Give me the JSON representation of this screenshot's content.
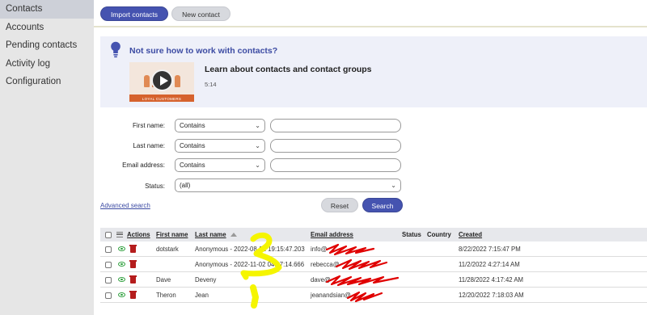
{
  "sidebar": {
    "items": [
      {
        "label": "Contacts",
        "active": true
      },
      {
        "label": "Accounts"
      },
      {
        "label": "Pending contacts"
      },
      {
        "label": "Activity log"
      },
      {
        "label": "Configuration"
      }
    ]
  },
  "toolbar": {
    "import_label": "Import contacts",
    "new_label": "New contact"
  },
  "info": {
    "title": "Not sure how to work with contacts?",
    "video_title": "Learn about contacts and contact groups",
    "video_duration": "5:14",
    "thumbnail_caption": "LOYAL CUSTOMERS",
    "icon": "lightbulb-icon"
  },
  "search": {
    "first_name_label": "First name:",
    "last_name_label": "Last name:",
    "email_label": "Email address:",
    "status_label": "Status:",
    "first_name_operator": "Contains",
    "last_name_operator": "Contains",
    "email_operator": "Contains",
    "status_value": "(all)",
    "advanced_link": "Advanced search",
    "reset_label": "Reset",
    "search_label": "Search"
  },
  "table": {
    "columns": {
      "actions": "Actions",
      "first_name": "First name",
      "last_name": "Last name",
      "email": "Email address",
      "status": "Status",
      "country": "Country",
      "created": "Created"
    },
    "sort": {
      "column": "last_name",
      "direction": "ascending"
    },
    "rows": [
      {
        "first_name": "dotstark",
        "last_name": "Anonymous - 2022-08-22 19:15:47.203",
        "email": "info@",
        "status": "",
        "country": "",
        "created": "8/22/2022 7:15:47 PM"
      },
      {
        "first_name": "",
        "last_name": "Anonymous - 2022-11-02 04:27:14.666",
        "email": "rebecca@",
        "status": "",
        "country": "",
        "created": "11/2/2022 4:27:14 AM"
      },
      {
        "first_name": "Dave",
        "last_name": "Deveny",
        "email": "dave@",
        "status": "",
        "country": "",
        "created": "11/28/2022 4:17:42 AM"
      },
      {
        "first_name": "Theron",
        "last_name": "Jean",
        "email": "jeanandsian@",
        "status": "",
        "country": "",
        "created": "12/20/2022 7:18:03 AM"
      }
    ]
  },
  "colors": {
    "accent": "#4553b0",
    "sidebar_active": "#cdd0d8",
    "redaction": "#e00000",
    "annotation": "#f5f500",
    "view_icon": "#2e9f3c",
    "delete_icon": "#b51d1d"
  }
}
